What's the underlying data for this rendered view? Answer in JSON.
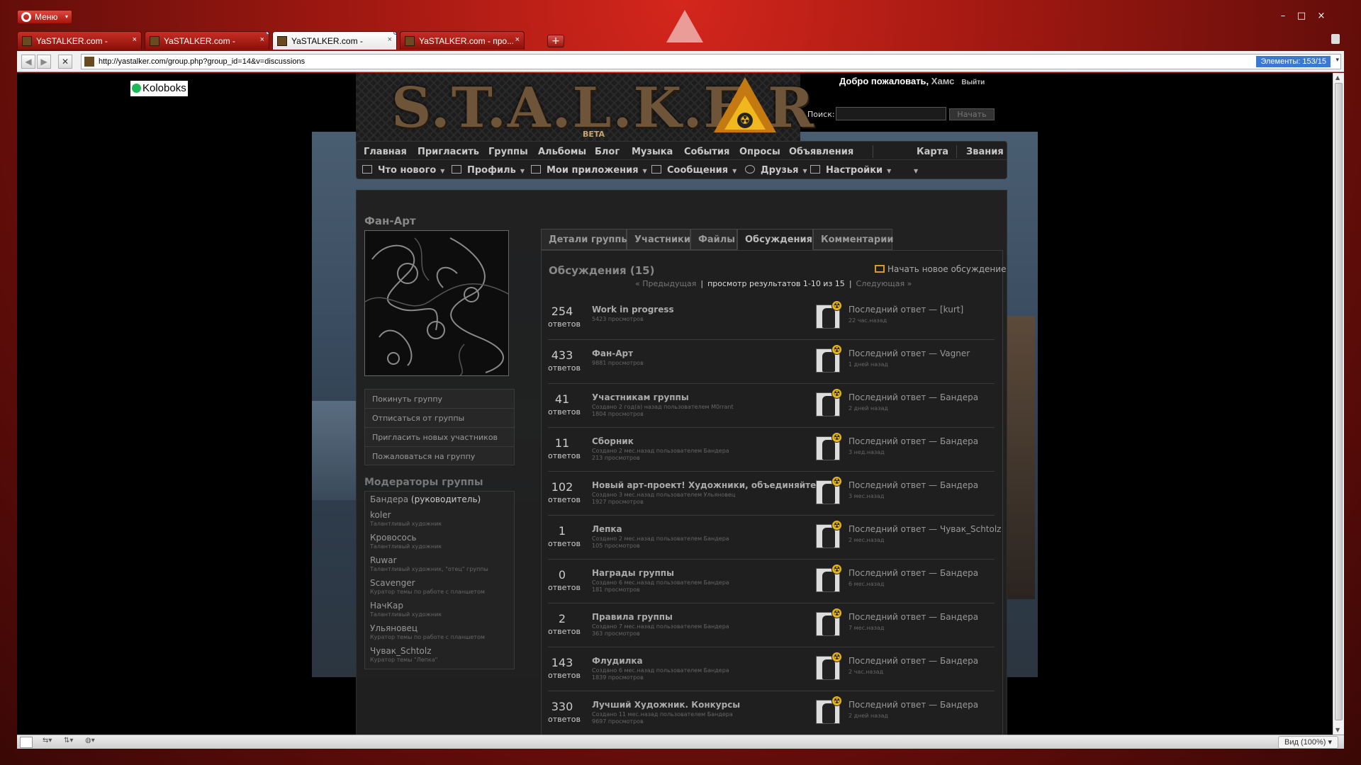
{
  "browser": {
    "menu_label": "Меню",
    "tabs": [
      {
        "title": "YaSTALKER.com -",
        "active": false
      },
      {
        "title": "YaSTALKER.com -",
        "active": false
      },
      {
        "title": "YaSTALKER.com -",
        "active": true
      },
      {
        "title": "YaSTALKER.com - про...",
        "active": false
      }
    ],
    "newtab_label": "+",
    "url": "http://yastalker.com/group.php?group_id=14&v=discussions",
    "elements_counter": "Элементы:  153/15",
    "zoom_label": "Вид (100%)",
    "window_controls": {
      "minimize": "–",
      "maximize": "□",
      "close": "×"
    }
  },
  "page": {
    "koloboks": "Koloboks",
    "logo": {
      "text": "S.T.A.L.K.E.R",
      "beta": "BETA"
    },
    "welcome": {
      "prefix": "Добро пожаловать,",
      "user": "Хамс",
      "logout": "Выйти"
    },
    "search": {
      "label": "Поиск:",
      "button": "Начать"
    },
    "nav_top": [
      "Главная",
      "Пригласить",
      "Группы",
      "Альбомы",
      "Блог",
      "Музыка",
      "События",
      "Опросы",
      "Объявления",
      "Карта",
      "Звания"
    ],
    "nav_bottom": [
      "Что нового",
      "Профиль",
      "Мои приложения",
      "Сообщения",
      "Друзья",
      "Настройки"
    ],
    "group": {
      "title": "Фан-Арт",
      "menu": [
        "Покинуть группу",
        "Отписаться от группы",
        "Пригласить новых участников",
        "Пожаловаться на группу"
      ],
      "mods_title": "Модераторы группы",
      "mods": [
        {
          "name": "Бандера",
          "role": "(руководитель)",
          "desc": ""
        },
        {
          "name": "koler",
          "role": "",
          "desc": "Талантливый художник"
        },
        {
          "name": "Кровосось",
          "role": "",
          "desc": "Талантливый художник"
        },
        {
          "name": "Ruwar",
          "role": "",
          "desc": "Талантливый художник, \"отец\" группы"
        },
        {
          "name": "Scavenger",
          "role": "",
          "desc": "Куратор темы по работе с планшетом"
        },
        {
          "name": "НачКар",
          "role": "",
          "desc": "Талантливый художник"
        },
        {
          "name": "Ульяновец",
          "role": "",
          "desc": "Куратор темы по работе с планшетом"
        },
        {
          "name": "Чувак_Schtolz",
          "role": "",
          "desc": "Куратор темы \"Лепка\""
        }
      ]
    },
    "content_tabs": [
      "Детали группы",
      "Участники",
      "Файлы",
      "Обсуждения",
      "Комментарии"
    ],
    "discussions": {
      "title": "Обсуждения (15)",
      "new_label": "Начать новое обсуждение",
      "pager": {
        "prev": "« Предыдущая",
        "current": "просмотр результатов 1-10 из 15",
        "next": "Следующая »",
        "sep": "|"
      },
      "count_label": "ответов",
      "threads": [
        {
          "count": "254",
          "title": "Work in progress",
          "meta1": "5423 просмотров",
          "meta2": "",
          "last": "Последний ответ — [kurt]",
          "time": "22 час.назад"
        },
        {
          "count": "433",
          "title": "Фан-Арт",
          "meta1": "9881 просмотров",
          "meta2": "",
          "last": "Последний ответ — Vagner",
          "time": "1 дней назад"
        },
        {
          "count": "41",
          "title": "Участникам группы",
          "meta1": "Создано 2 год(а) назад пользователем M0rrant",
          "meta2": "1804 просмотров",
          "last": "Последний ответ — Бандера",
          "time": "2 дней назад"
        },
        {
          "count": "11",
          "title": "Сборник",
          "meta1": "Создано 2 мес.назад пользователем Бандера",
          "meta2": "213 просмотров",
          "last": "Последний ответ — Бандера",
          "time": "3 нед.назад"
        },
        {
          "count": "102",
          "title": "Новый арт-проект! Художники, объединяйтесь!",
          "meta1": "Создано 3 мес.назад пользователем Ульяновец",
          "meta2": "1927 просмотров",
          "last": "Последний ответ — Бандера",
          "time": "3 мес.назад"
        },
        {
          "count": "1",
          "title": "Лепка",
          "meta1": "Создано 2 мес.назад пользователем Бандера",
          "meta2": "105 просмотров",
          "last": "Последний ответ — Чувак_Schtolz",
          "time": "2 мес.назад"
        },
        {
          "count": "0",
          "title": "Награды группы",
          "meta1": "Создано 6 мес.назад пользователем Бандера",
          "meta2": "181 просмотров",
          "last": "Последний ответ — Бандера",
          "time": "6 мес.назад"
        },
        {
          "count": "2",
          "title": "Правила группы",
          "meta1": "Создано 7 мес.назад пользователем Бандера",
          "meta2": "363 просмотров",
          "last": "Последний ответ — Бандера",
          "time": "7 мес.назад"
        },
        {
          "count": "143",
          "title": "Флудилка",
          "meta1": "Создано 6 мес.назад пользователем Бандера",
          "meta2": "1839 просмотров",
          "last": "Последний ответ — Бандера",
          "time": "2 час.назад"
        },
        {
          "count": "330",
          "title": "Лучший Художник. Конкурсы",
          "meta1": "Создано 11 мес.назад пользователем Бандера",
          "meta2": "9697 просмотров",
          "last": "Последний ответ — Бандера",
          "time": "2 дней назад"
        }
      ]
    }
  }
}
